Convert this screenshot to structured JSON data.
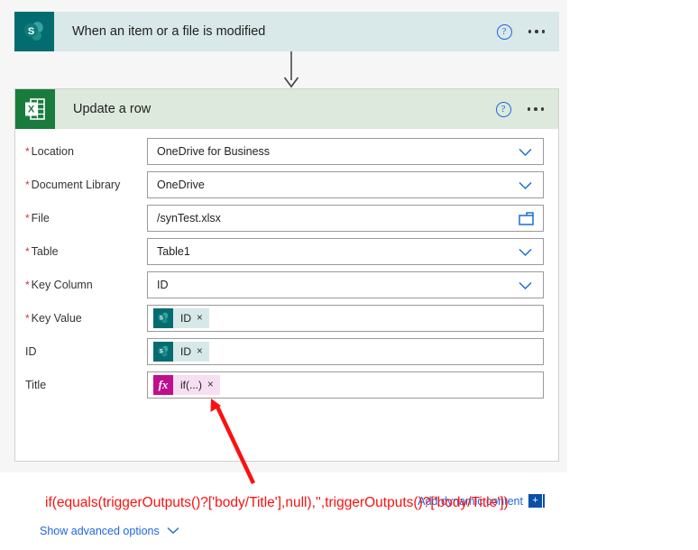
{
  "trigger_card": {
    "icon": "sharepoint-icon",
    "title": "When an item or a file is modified",
    "help_label": "?",
    "more_label": "..."
  },
  "action_card": {
    "icon": "excel-icon",
    "title": "Update a row",
    "help_label": "?",
    "more_label": "...",
    "fields": [
      {
        "label": "Location",
        "required": true,
        "value": "OneDrive for Business",
        "control": "dropdown"
      },
      {
        "label": "Document Library",
        "required": true,
        "value": "OneDrive",
        "control": "dropdown"
      },
      {
        "label": "File",
        "required": true,
        "value": "/synTest.xlsx",
        "control": "folder"
      },
      {
        "label": "Table",
        "required": true,
        "value": "Table1",
        "control": "dropdown"
      },
      {
        "label": "Key Column",
        "required": true,
        "value": "ID",
        "control": "dropdown"
      },
      {
        "label": "Key Value",
        "required": true,
        "value": "",
        "control": "token",
        "token": {
          "kind": "sharepoint",
          "text": "ID",
          "remove": "×"
        }
      },
      {
        "label": "ID",
        "required": false,
        "value": "",
        "control": "token",
        "token": {
          "kind": "sharepoint",
          "text": "ID",
          "remove": "×"
        }
      },
      {
        "label": "Title",
        "required": false,
        "value": "",
        "control": "token",
        "token": {
          "kind": "expression",
          "icon_label": "fx",
          "text": "if(...)",
          "remove": "×"
        }
      }
    ],
    "add_dynamic_content": "Add dynamic content",
    "add_dynamic_badge": "+",
    "show_advanced_options": "Show advanced options"
  },
  "annotation": {
    "formula": "if(equals(triggerOutputs()?['body/Title'],null),'',triggerOutputs()?['body/Title'])",
    "arrow_color": "#fb1111"
  },
  "colors": {
    "sharepoint_teal": "#036c70",
    "excel_green": "#197b3c",
    "trigger_header_bg": "#d9e8e8",
    "action_header_bg": "#dce9dc",
    "link_blue": "#2266dd",
    "required_red": "#d13438",
    "expression_magenta": "#c00f8e",
    "canvas_bg": "#f6f6f6"
  }
}
